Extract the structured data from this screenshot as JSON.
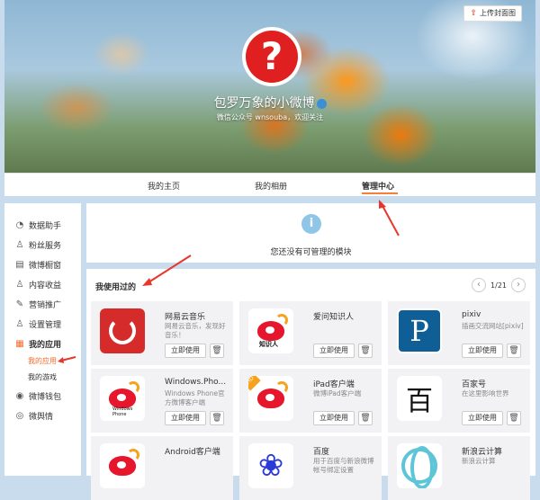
{
  "cover": {
    "upload_label": "上传封面图",
    "profile_name": "包罗万象的小微博",
    "profile_sub": "微信公众号 wnsouba，欢迎关注"
  },
  "tabs": [
    "我的主页",
    "我的相册",
    "管理中心"
  ],
  "active_tab": "管理中心",
  "sidebar": {
    "items": [
      {
        "label": "数据助手",
        "icon": "chart-icon"
      },
      {
        "label": "粉丝服务",
        "icon": "fans-icon"
      },
      {
        "label": "微博橱窗",
        "icon": "shop-icon"
      },
      {
        "label": "内容收益",
        "icon": "income-icon"
      },
      {
        "label": "营销推广",
        "icon": "promote-icon"
      },
      {
        "label": "设置管理",
        "icon": "settings-icon"
      },
      {
        "label": "我的应用",
        "icon": "apps-icon"
      },
      {
        "label": "微博钱包",
        "icon": "wallet-icon"
      },
      {
        "label": "微舆情",
        "icon": "sentiment-icon"
      }
    ],
    "sub_items": [
      "我的应用",
      "我的游戏"
    ],
    "active_sub": "我的应用"
  },
  "notice": {
    "text": "您还没有可管理的模块"
  },
  "apps": {
    "title": "我使用过的",
    "page": "1/21",
    "use_label": "立即使用",
    "list": [
      {
        "name": "网易云音乐",
        "desc": "网易云音乐，发现好音乐！",
        "logo": "netease-music-logo"
      },
      {
        "name": "爱问知识人",
        "desc": "",
        "logo": "iask-logo",
        "logo_text": "知识人"
      },
      {
        "name": "pixiv",
        "desc": "插画交流网站[pixiv]",
        "logo": "pixiv-logo",
        "logo_text": "P"
      },
      {
        "name": "Windows.Pho...",
        "desc": "Windows Phone官方微博客户端",
        "logo": "windows-phone-weibo-logo",
        "logo_text": "Windows Phone"
      },
      {
        "name": "iPad客户端",
        "desc": "微博iPad客户端",
        "logo": "ipad-weibo-logo",
        "logo_text": "HD"
      },
      {
        "name": "百家号",
        "desc": "在这里影响世界",
        "logo": "baijiahao-logo",
        "logo_text": "百"
      },
      {
        "name": "Android客户端",
        "desc": "",
        "logo": "android-weibo-logo"
      },
      {
        "name": "百度",
        "desc": "用于百度与新浪微博帐号绑定设置",
        "logo": "baidu-logo"
      },
      {
        "name": "新浪云计算",
        "desc": "新浪云计算",
        "logo": "sina-cloud-logo"
      }
    ]
  },
  "colors": {
    "accent": "#fa7d3c",
    "background": "#c8dced",
    "annotation_arrow": "#e8362b"
  }
}
